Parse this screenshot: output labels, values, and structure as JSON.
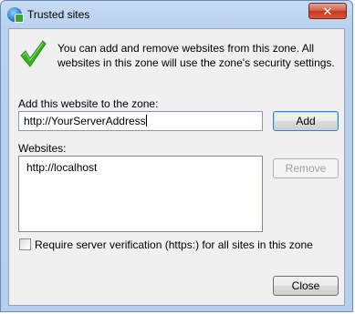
{
  "window": {
    "title": "Trusted sites",
    "close_glyph": "✕"
  },
  "info": {
    "message": "You can add and remove websites from this zone. All websites in this zone will use the zone's security settings."
  },
  "add": {
    "label": "Add this website to the zone:",
    "value": "http://YourServerAddress",
    "button": "Add"
  },
  "websites": {
    "label": "Websites:",
    "items": [
      "http://localhost"
    ],
    "remove_button": "Remove"
  },
  "verification": {
    "label": "Require server verification (https:) for all sites in this zone",
    "checked": false
  },
  "footer": {
    "close_button": "Close"
  },
  "colors": {
    "check_green": "#3fae2a",
    "title_bar": "#b9d1ee",
    "close_red": "#c23a1f"
  }
}
